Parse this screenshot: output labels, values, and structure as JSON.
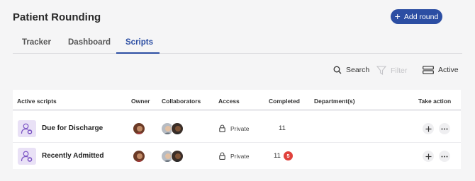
{
  "page": {
    "title": "Patient Rounding"
  },
  "header": {
    "add_round_label": "Add round"
  },
  "tabs": [
    {
      "label": "Tracker",
      "active": false
    },
    {
      "label": "Dashboard",
      "active": false
    },
    {
      "label": "Scripts",
      "active": true
    }
  ],
  "toolbar": {
    "search_label": "Search",
    "filter_label": "Filter",
    "active_label": "Active"
  },
  "table": {
    "columns": [
      "Active scripts",
      "Owner",
      "Collaborators",
      "Access",
      "Completed",
      "Department(s)",
      "Take action"
    ],
    "rows": [
      {
        "name": "Due for Discharge",
        "access": "Private",
        "completed": "11",
        "badge": ""
      },
      {
        "name": "Recently Admitted",
        "access": "Private",
        "completed": "11",
        "badge": "5"
      }
    ]
  },
  "colors": {
    "primary": "#2c4ea3",
    "badge": "#e0413b",
    "icon_bg": "#e9e1f6",
    "icon_fg": "#7b54c4"
  }
}
